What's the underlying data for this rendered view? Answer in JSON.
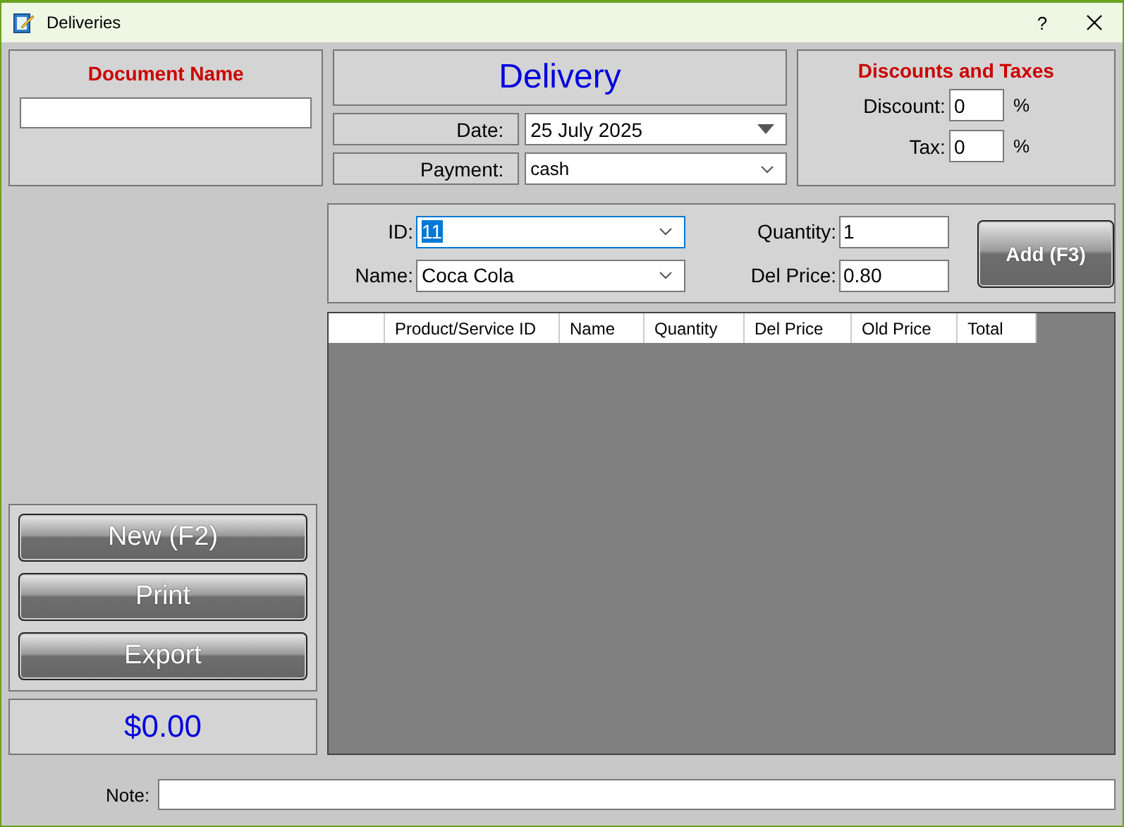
{
  "window": {
    "title": "Deliveries",
    "help_button": "?"
  },
  "document_name": {
    "heading": "Document Name"
  },
  "header": {
    "title": "Delivery",
    "date_label": "Date:",
    "date": "25 July 2025",
    "payment_label": "Payment:",
    "payment": "cash"
  },
  "discounts": {
    "heading": "Discounts and Taxes",
    "fields": [
      {
        "label": "Discount:",
        "value": "0",
        "unit": "%"
      },
      {
        "label": "Tax:",
        "value": "0",
        "unit": "%"
      }
    ]
  },
  "entry": {
    "id_label": "ID:",
    "id": "11",
    "id_text_selected": true,
    "name_label": "Name:",
    "name": "Coca Cola",
    "quantity_label": "Quantity:",
    "quantity": "1",
    "price_label": "Del Price:",
    "price": "0.80",
    "add_button": "Add (F3)"
  },
  "table": {
    "columns": [
      "Product/Service ID",
      "Name",
      "Quantity",
      "Del Price",
      "Old Price",
      "Total"
    ]
  },
  "actions": [
    "New (F2)",
    "Print",
    "Export"
  ],
  "total": "$0.00",
  "note": {
    "label": "Note:"
  }
}
